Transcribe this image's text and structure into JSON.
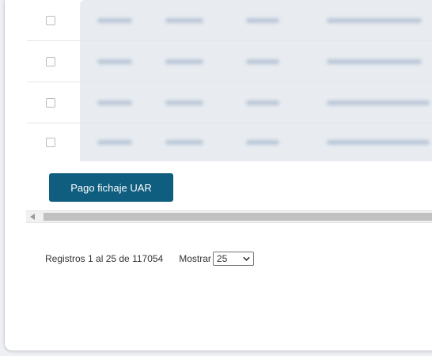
{
  "table": {
    "rows": [
      {
        "checked": false
      },
      {
        "checked": false
      },
      {
        "checked": false
      },
      {
        "checked": false
      }
    ]
  },
  "actions": {
    "pay_button_label": "Pago fichaje UAR"
  },
  "pagination": {
    "records_text": "Registros 1 al 25 de 117054",
    "show_label": "Mostrar",
    "page_size": "25"
  },
  "colors": {
    "primary_button": "#0f5e7f",
    "scrollbar_thumb": "#c1c1c1"
  },
  "icons": {
    "scroll_left": "triangle-left-icon",
    "select_caret": "chevron-down-icon"
  }
}
